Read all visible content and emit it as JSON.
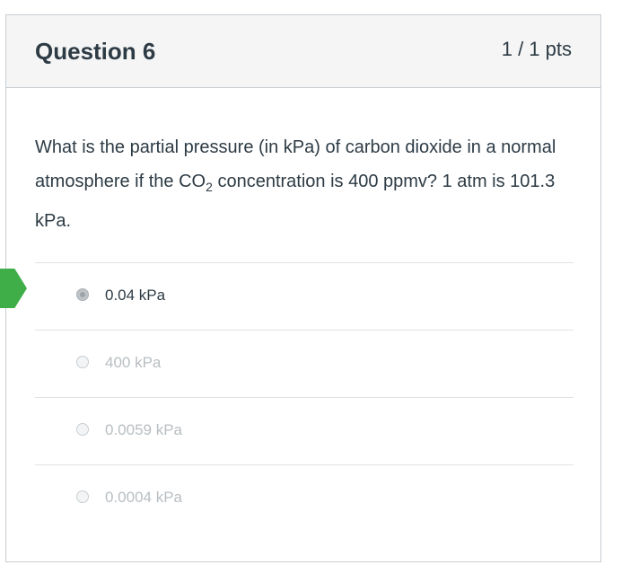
{
  "question": {
    "title": "Question 6",
    "points": "1 / 1 pts",
    "text_before": "What is the partial pressure (in kPa) of carbon dioxide in a normal atmosphere if the CO",
    "text_sub": "2",
    "text_after": " concentration is 400 ppmv? 1 atm is 101.3 kPa."
  },
  "answers": [
    {
      "label": "0.04 kPa",
      "selected": true
    },
    {
      "label": "400 kPa",
      "selected": false
    },
    {
      "label": "0.0059 kPa",
      "selected": false
    },
    {
      "label": "0.0004 kPa",
      "selected": false
    }
  ],
  "colors": {
    "correct_marker": "#3fae49",
    "header_bg": "#f5f5f5",
    "text": "#2d3b45"
  },
  "icons": {
    "correct_marker": "correct-answer-marker-icon"
  }
}
